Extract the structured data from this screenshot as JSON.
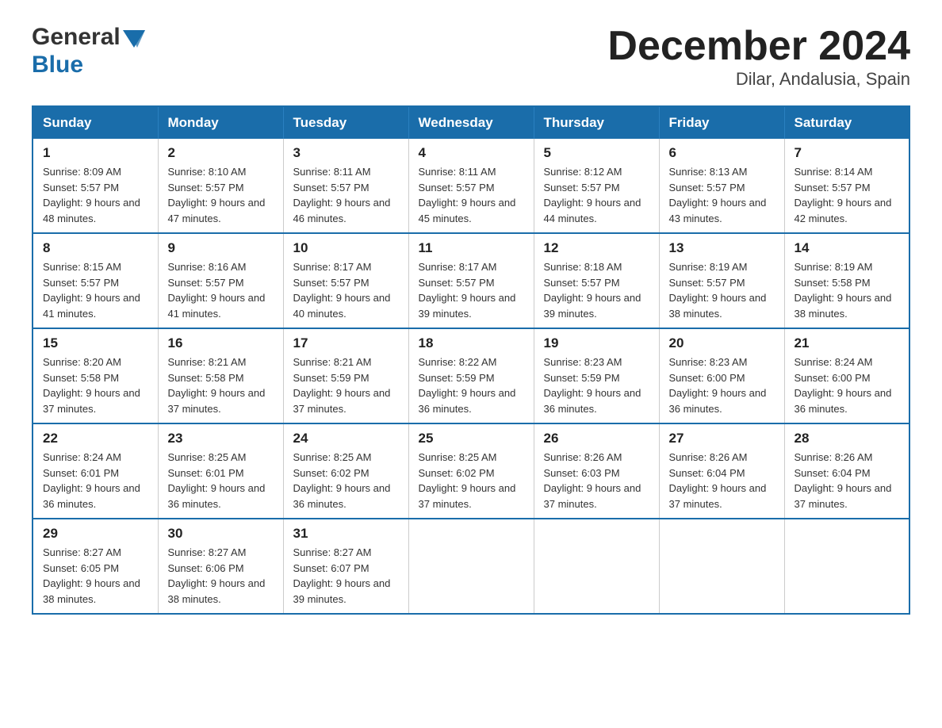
{
  "header": {
    "logo_general": "General",
    "logo_blue": "Blue",
    "month_title": "December 2024",
    "subtitle": "Dilar, Andalusia, Spain"
  },
  "days_of_week": [
    "Sunday",
    "Monday",
    "Tuesday",
    "Wednesday",
    "Thursday",
    "Friday",
    "Saturday"
  ],
  "weeks": [
    [
      {
        "day": "1",
        "sunrise": "Sunrise: 8:09 AM",
        "sunset": "Sunset: 5:57 PM",
        "daylight": "Daylight: 9 hours and 48 minutes."
      },
      {
        "day": "2",
        "sunrise": "Sunrise: 8:10 AM",
        "sunset": "Sunset: 5:57 PM",
        "daylight": "Daylight: 9 hours and 47 minutes."
      },
      {
        "day": "3",
        "sunrise": "Sunrise: 8:11 AM",
        "sunset": "Sunset: 5:57 PM",
        "daylight": "Daylight: 9 hours and 46 minutes."
      },
      {
        "day": "4",
        "sunrise": "Sunrise: 8:11 AM",
        "sunset": "Sunset: 5:57 PM",
        "daylight": "Daylight: 9 hours and 45 minutes."
      },
      {
        "day": "5",
        "sunrise": "Sunrise: 8:12 AM",
        "sunset": "Sunset: 5:57 PM",
        "daylight": "Daylight: 9 hours and 44 minutes."
      },
      {
        "day": "6",
        "sunrise": "Sunrise: 8:13 AM",
        "sunset": "Sunset: 5:57 PM",
        "daylight": "Daylight: 9 hours and 43 minutes."
      },
      {
        "day": "7",
        "sunrise": "Sunrise: 8:14 AM",
        "sunset": "Sunset: 5:57 PM",
        "daylight": "Daylight: 9 hours and 42 minutes."
      }
    ],
    [
      {
        "day": "8",
        "sunrise": "Sunrise: 8:15 AM",
        "sunset": "Sunset: 5:57 PM",
        "daylight": "Daylight: 9 hours and 41 minutes."
      },
      {
        "day": "9",
        "sunrise": "Sunrise: 8:16 AM",
        "sunset": "Sunset: 5:57 PM",
        "daylight": "Daylight: 9 hours and 41 minutes."
      },
      {
        "day": "10",
        "sunrise": "Sunrise: 8:17 AM",
        "sunset": "Sunset: 5:57 PM",
        "daylight": "Daylight: 9 hours and 40 minutes."
      },
      {
        "day": "11",
        "sunrise": "Sunrise: 8:17 AM",
        "sunset": "Sunset: 5:57 PM",
        "daylight": "Daylight: 9 hours and 39 minutes."
      },
      {
        "day": "12",
        "sunrise": "Sunrise: 8:18 AM",
        "sunset": "Sunset: 5:57 PM",
        "daylight": "Daylight: 9 hours and 39 minutes."
      },
      {
        "day": "13",
        "sunrise": "Sunrise: 8:19 AM",
        "sunset": "Sunset: 5:57 PM",
        "daylight": "Daylight: 9 hours and 38 minutes."
      },
      {
        "day": "14",
        "sunrise": "Sunrise: 8:19 AM",
        "sunset": "Sunset: 5:58 PM",
        "daylight": "Daylight: 9 hours and 38 minutes."
      }
    ],
    [
      {
        "day": "15",
        "sunrise": "Sunrise: 8:20 AM",
        "sunset": "Sunset: 5:58 PM",
        "daylight": "Daylight: 9 hours and 37 minutes."
      },
      {
        "day": "16",
        "sunrise": "Sunrise: 8:21 AM",
        "sunset": "Sunset: 5:58 PM",
        "daylight": "Daylight: 9 hours and 37 minutes."
      },
      {
        "day": "17",
        "sunrise": "Sunrise: 8:21 AM",
        "sunset": "Sunset: 5:59 PM",
        "daylight": "Daylight: 9 hours and 37 minutes."
      },
      {
        "day": "18",
        "sunrise": "Sunrise: 8:22 AM",
        "sunset": "Sunset: 5:59 PM",
        "daylight": "Daylight: 9 hours and 36 minutes."
      },
      {
        "day": "19",
        "sunrise": "Sunrise: 8:23 AM",
        "sunset": "Sunset: 5:59 PM",
        "daylight": "Daylight: 9 hours and 36 minutes."
      },
      {
        "day": "20",
        "sunrise": "Sunrise: 8:23 AM",
        "sunset": "Sunset: 6:00 PM",
        "daylight": "Daylight: 9 hours and 36 minutes."
      },
      {
        "day": "21",
        "sunrise": "Sunrise: 8:24 AM",
        "sunset": "Sunset: 6:00 PM",
        "daylight": "Daylight: 9 hours and 36 minutes."
      }
    ],
    [
      {
        "day": "22",
        "sunrise": "Sunrise: 8:24 AM",
        "sunset": "Sunset: 6:01 PM",
        "daylight": "Daylight: 9 hours and 36 minutes."
      },
      {
        "day": "23",
        "sunrise": "Sunrise: 8:25 AM",
        "sunset": "Sunset: 6:01 PM",
        "daylight": "Daylight: 9 hours and 36 minutes."
      },
      {
        "day": "24",
        "sunrise": "Sunrise: 8:25 AM",
        "sunset": "Sunset: 6:02 PM",
        "daylight": "Daylight: 9 hours and 36 minutes."
      },
      {
        "day": "25",
        "sunrise": "Sunrise: 8:25 AM",
        "sunset": "Sunset: 6:02 PM",
        "daylight": "Daylight: 9 hours and 37 minutes."
      },
      {
        "day": "26",
        "sunrise": "Sunrise: 8:26 AM",
        "sunset": "Sunset: 6:03 PM",
        "daylight": "Daylight: 9 hours and 37 minutes."
      },
      {
        "day": "27",
        "sunrise": "Sunrise: 8:26 AM",
        "sunset": "Sunset: 6:04 PM",
        "daylight": "Daylight: 9 hours and 37 minutes."
      },
      {
        "day": "28",
        "sunrise": "Sunrise: 8:26 AM",
        "sunset": "Sunset: 6:04 PM",
        "daylight": "Daylight: 9 hours and 37 minutes."
      }
    ],
    [
      {
        "day": "29",
        "sunrise": "Sunrise: 8:27 AM",
        "sunset": "Sunset: 6:05 PM",
        "daylight": "Daylight: 9 hours and 38 minutes."
      },
      {
        "day": "30",
        "sunrise": "Sunrise: 8:27 AM",
        "sunset": "Sunset: 6:06 PM",
        "daylight": "Daylight: 9 hours and 38 minutes."
      },
      {
        "day": "31",
        "sunrise": "Sunrise: 8:27 AM",
        "sunset": "Sunset: 6:07 PM",
        "daylight": "Daylight: 9 hours and 39 minutes."
      },
      null,
      null,
      null,
      null
    ]
  ]
}
